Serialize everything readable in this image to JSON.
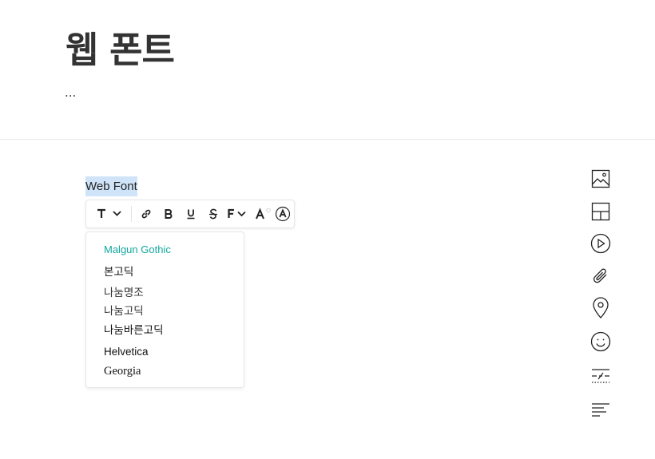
{
  "page": {
    "title": "웹 폰트",
    "subtitle": "..."
  },
  "editor": {
    "selected_text": "Web Font"
  },
  "toolbar": {
    "items": [
      {
        "name": "text-style",
        "icon": "text-style-icon"
      },
      {
        "name": "link",
        "icon": "link-icon"
      },
      {
        "name": "bold",
        "icon": "bold-icon"
      },
      {
        "name": "underline",
        "icon": "underline-icon"
      },
      {
        "name": "strikethrough",
        "icon": "strikethrough-icon"
      },
      {
        "name": "font-family",
        "icon": "font-family-icon"
      },
      {
        "name": "font-color",
        "icon": "font-color-icon"
      },
      {
        "name": "highlight-color",
        "icon": "highlight-color-icon"
      }
    ]
  },
  "font_dropdown": {
    "selected": "Malgun Gothic",
    "options": [
      "Malgun Gothic",
      "본고딕",
      "나눔명조",
      "나눔고딕",
      "나눔바른고딕",
      "Helvetica",
      "Georgia"
    ]
  },
  "sidebar": {
    "tools": [
      "image-icon",
      "layout-icon",
      "video-icon",
      "attachment-icon",
      "location-icon",
      "emoji-icon",
      "divider-icon",
      "text-align-icon"
    ]
  },
  "colors": {
    "accent": "#13a89e",
    "selection": "#cfe4f8",
    "divider": "#e9e9e9"
  }
}
